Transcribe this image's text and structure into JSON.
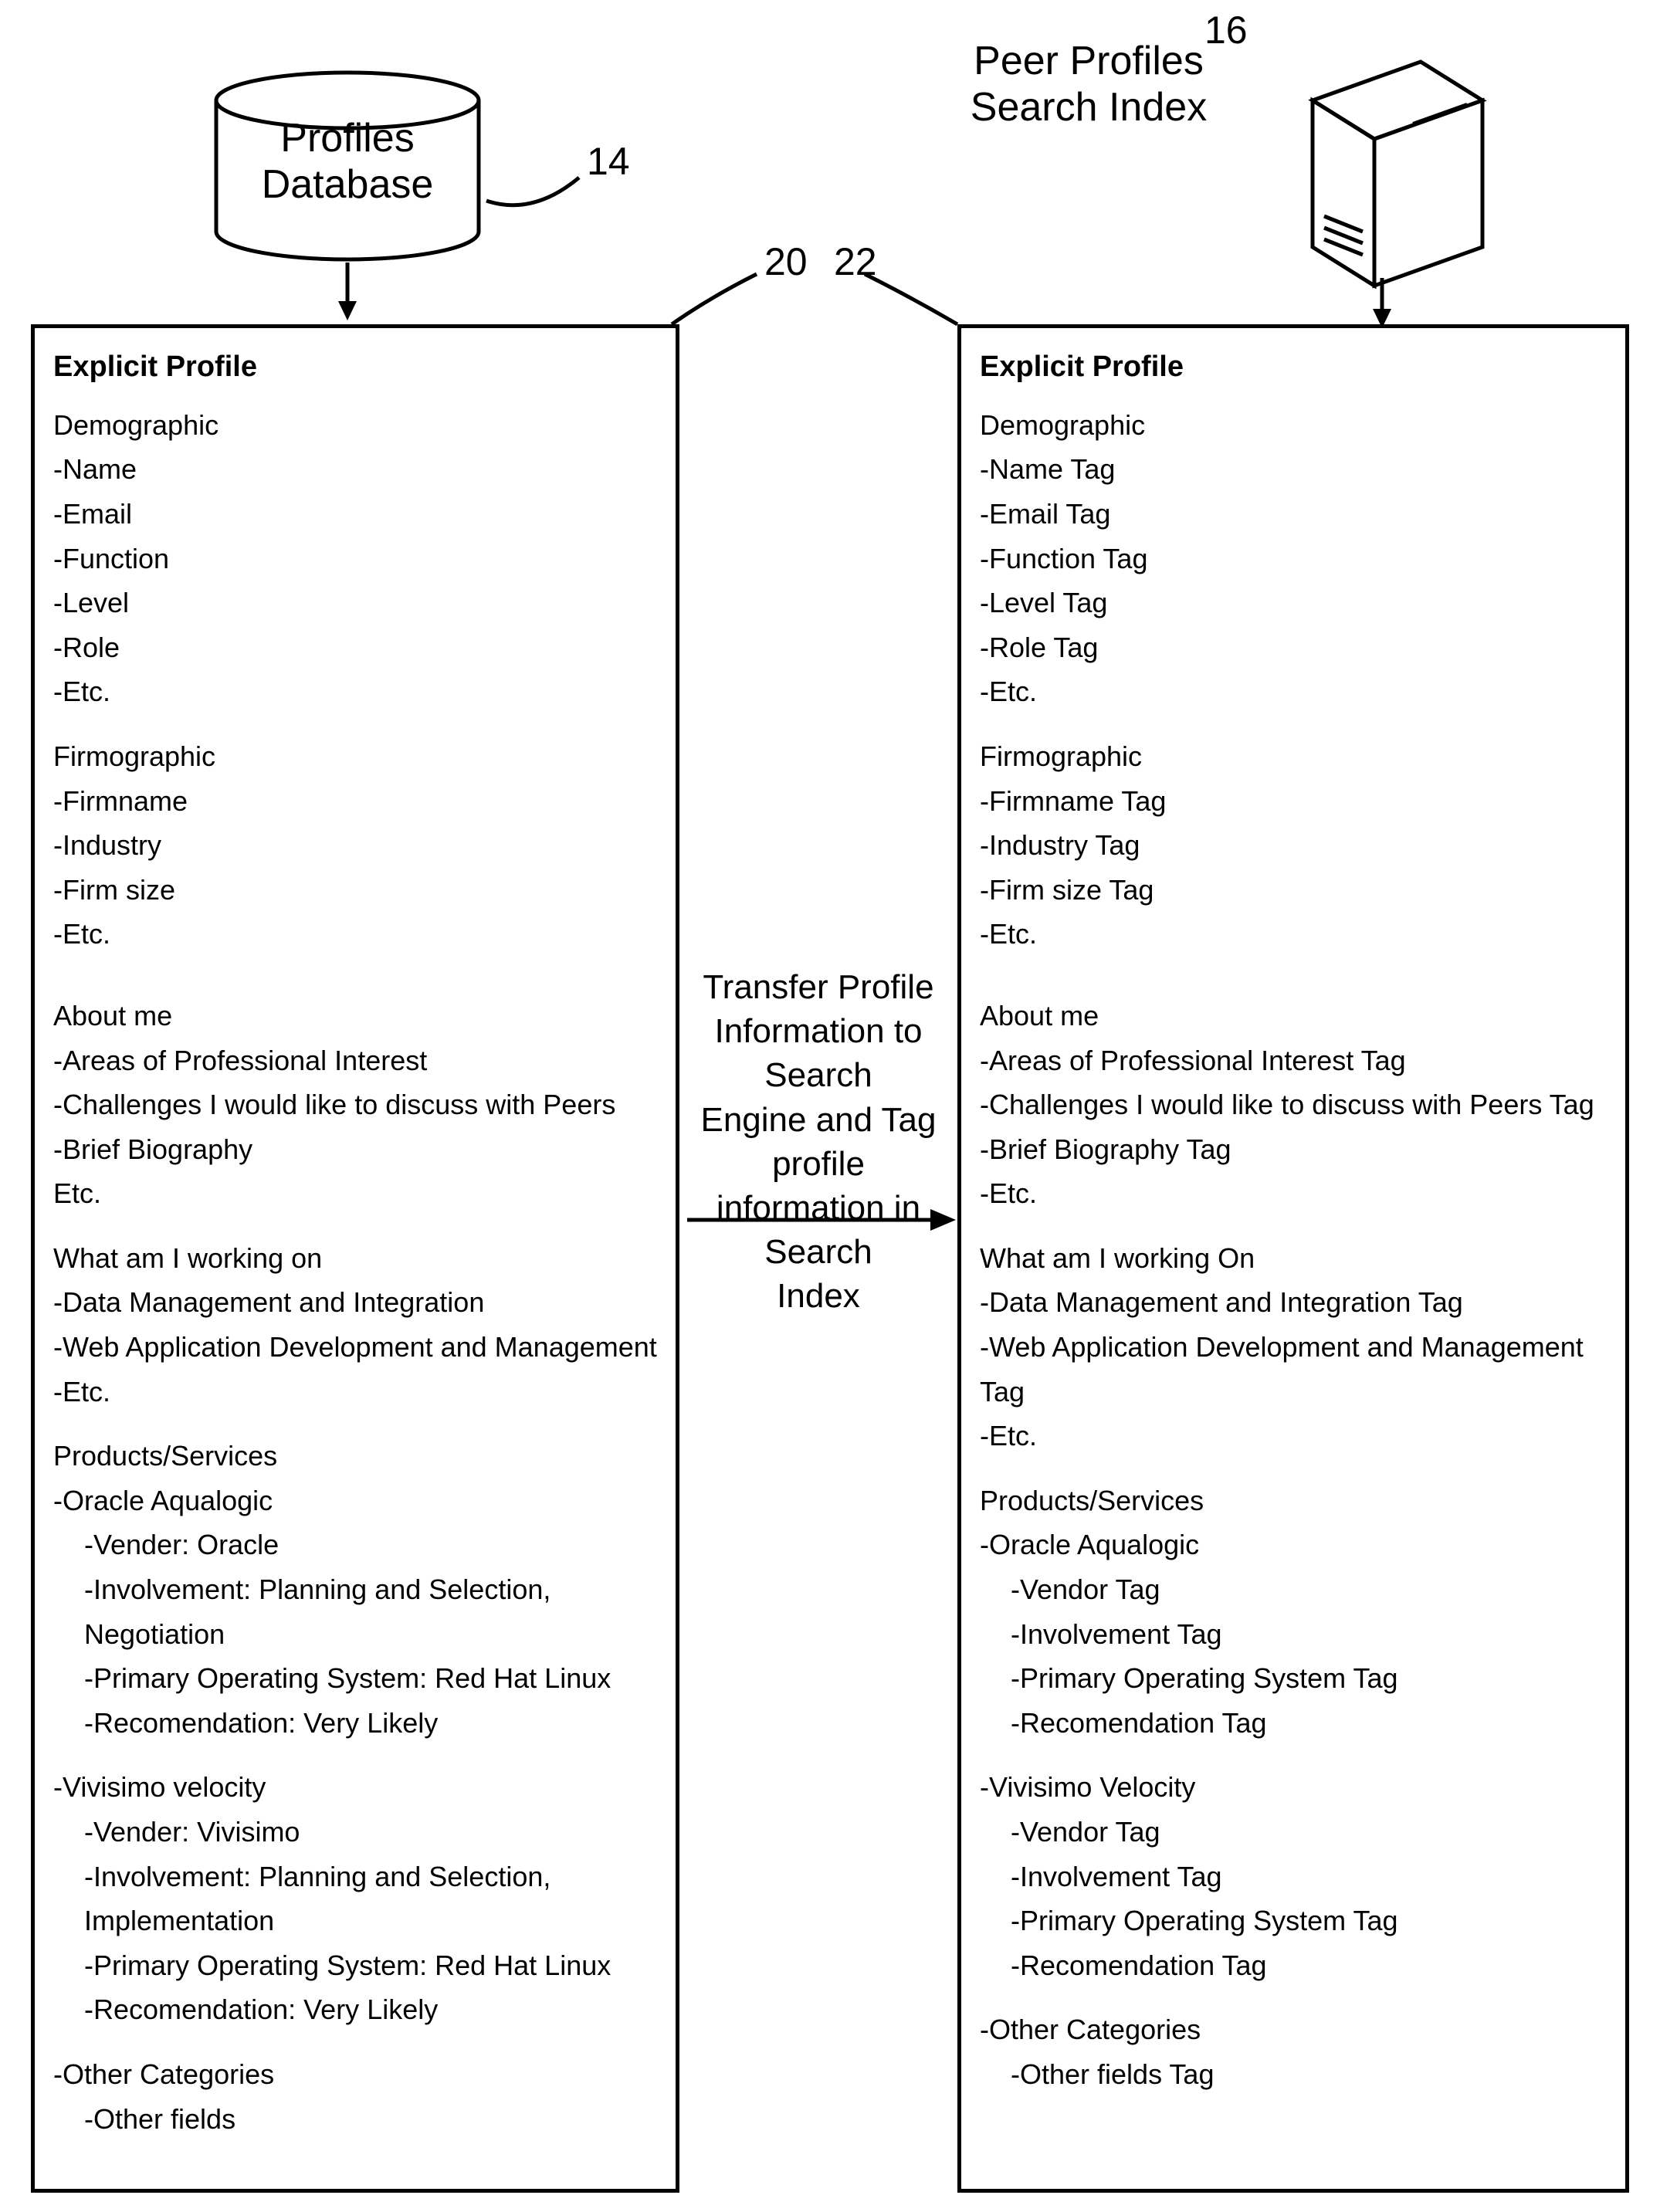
{
  "refs": {
    "db": "14",
    "server": "16",
    "leftPanel": "20",
    "rightPanel": "22"
  },
  "top": {
    "dbLabel1": "Profiles",
    "dbLabel2": "Database",
    "serverLabel1": "Peer Profiles",
    "serverLabel2": "Search Index"
  },
  "center": {
    "l1": "Transfer Profile",
    "l2": "Information to Search",
    "l3": "Engine and Tag profile",
    "l4": "information in Search",
    "l5": "Index"
  },
  "left": {
    "title": "Explicit Profile",
    "demo_head": "Demographic",
    "demo_1": "-Name",
    "demo_2": "-Email",
    "demo_3": "-Function",
    "demo_4": "-Level",
    "demo_5": "-Role",
    "demo_6": "-Etc.",
    "firm_head": "Firmographic",
    "firm_1": "-Firmname",
    "firm_2": "-Industry",
    "firm_3": "-Firm size",
    "firm_4": "-Etc.",
    "about_head": "About me",
    "about_1": "-Areas of Professional Interest",
    "about_2": "-Challenges I would like to discuss with Peers",
    "about_3": "-Brief Biography",
    "about_4": "Etc.",
    "work_head": "What am I working on",
    "work_1": "-Data Management and Integration",
    "work_2": "-Web Application Development and Management",
    "work_3": "-Etc.",
    "prod_head": "Products/Services",
    "prod_a_name": "-Oracle Aqualogic",
    "prod_a_1": "-Vender: Oracle",
    "prod_a_2": "-Involvement: Planning and Selection, Negotiation",
    "prod_a_3": "-Primary Operating System: Red Hat Linux",
    "prod_a_4": "-Recomendation: Very Likely",
    "prod_b_name": "-Vivisimo velocity",
    "prod_b_1": "-Vender: Vivisimo",
    "prod_b_2": "-Involvement: Planning and Selection, Implementation",
    "prod_b_3": "-Primary Operating System: Red Hat Linux",
    "prod_b_4": "-Recomendation: Very Likely",
    "other_head": "-Other Categories",
    "other_1": "-Other fields"
  },
  "right": {
    "title": "Explicit Profile",
    "demo_head": "Demographic",
    "demo_1": "-Name Tag",
    "demo_2": "-Email Tag",
    "demo_3": "-Function Tag",
    "demo_4": "-Level Tag",
    "demo_5": "-Role Tag",
    "demo_6": "-Etc.",
    "firm_head": "Firmographic",
    "firm_1": "-Firmname Tag",
    "firm_2": "-Industry Tag",
    "firm_3": "-Firm size Tag",
    "firm_4": "-Etc.",
    "about_head": "About me",
    "about_1": "-Areas of Professional Interest Tag",
    "about_2": "-Challenges I would like to discuss with Peers Tag",
    "about_3": "-Brief Biography Tag",
    "about_4": "-Etc.",
    "work_head": "What am I working On",
    "work_1": "-Data Management and Integration Tag",
    "work_2": "-Web Application Development and Management Tag",
    "work_3": "-Etc.",
    "prod_head": "Products/Services",
    "prod_a_name": "-Oracle Aqualogic",
    "prod_a_1": "-Vendor Tag",
    "prod_a_2": "-Involvement Tag",
    "prod_a_3": "-Primary Operating System Tag",
    "prod_a_4": "-Recomendation Tag",
    "prod_b_name": "-Vivisimo Velocity",
    "prod_b_1": "-Vendor Tag",
    "prod_b_2": "-Involvement Tag",
    "prod_b_3": "-Primary Operating System Tag",
    "prod_b_4": "-Recomendation Tag",
    "other_head": "-Other Categories",
    "other_1": "-Other fields Tag"
  }
}
